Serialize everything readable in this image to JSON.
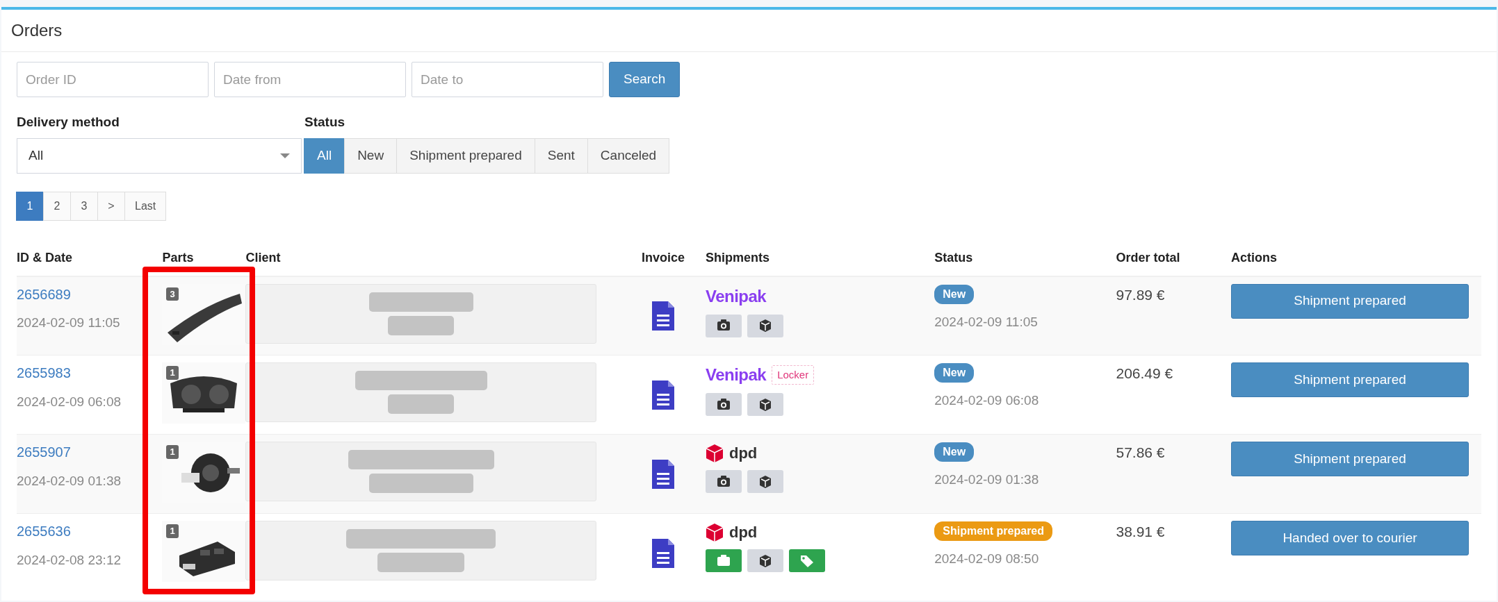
{
  "title": "Orders",
  "filters": {
    "fields": [
      {
        "placeholder": "Order ID"
      },
      {
        "placeholder": "Date from"
      },
      {
        "placeholder": "Date to"
      }
    ],
    "search_button": "Search",
    "delivery": {
      "label": "Delivery method",
      "value": "All"
    },
    "status": {
      "label": "Status",
      "options": [
        {
          "label": "All",
          "selected": true
        },
        {
          "label": "New",
          "selected": false
        },
        {
          "label": "Shipment prepared",
          "selected": false
        },
        {
          "label": "Sent",
          "selected": false
        },
        {
          "label": "Canceled",
          "selected": false
        }
      ]
    }
  },
  "pagination": [
    {
      "label": "1",
      "selected": true
    },
    {
      "label": "2",
      "selected": false
    },
    {
      "label": "3",
      "selected": false
    },
    {
      "label": ">",
      "selected": false
    },
    {
      "label": "Last",
      "selected": false
    }
  ],
  "table": {
    "columns": [
      "ID & Date",
      "Parts",
      "Client",
      "Invoice",
      "Shipments",
      "Status",
      "Order total",
      "Actions"
    ],
    "parts_highlighted": true,
    "rows": [
      {
        "id": "2656689",
        "date": "2024-02-09 11:05",
        "parts_count": "3",
        "carrier": {
          "kind": "venipak",
          "name": "Venipak"
        },
        "tags": [],
        "shipment_buttons": [
          {
            "kind": "camera",
            "done": false
          },
          {
            "kind": "box",
            "done": false
          }
        ],
        "status": {
          "label": "New",
          "color": "#4a8dc1"
        },
        "status_date": "2024-02-09 11:05",
        "total": "97.89 €",
        "action": "Shipment prepared"
      },
      {
        "id": "2655983",
        "date": "2024-02-09 06:08",
        "parts_count": "1",
        "carrier": {
          "kind": "venipak",
          "name": "Venipak"
        },
        "tags": [
          "Locker"
        ],
        "shipment_buttons": [
          {
            "kind": "camera",
            "done": false
          },
          {
            "kind": "box",
            "done": false
          }
        ],
        "status": {
          "label": "New",
          "color": "#4a8dc1"
        },
        "status_date": "2024-02-09 06:08",
        "total": "206.49 €",
        "action": "Shipment prepared"
      },
      {
        "id": "2655907",
        "date": "2024-02-09 01:38",
        "parts_count": "1",
        "carrier": {
          "kind": "dpd",
          "name": "dpd"
        },
        "tags": [],
        "shipment_buttons": [
          {
            "kind": "camera",
            "done": false
          },
          {
            "kind": "box",
            "done": false
          }
        ],
        "status": {
          "label": "New",
          "color": "#4a8dc1"
        },
        "status_date": "2024-02-09 01:38",
        "total": "57.86 €",
        "action": "Shipment prepared"
      },
      {
        "id": "2655636",
        "date": "2024-02-08 23:12",
        "parts_count": "1",
        "carrier": {
          "kind": "dpd",
          "name": "dpd"
        },
        "tags": [],
        "shipment_buttons": [
          {
            "kind": "camera",
            "done": true
          },
          {
            "kind": "box",
            "done": false
          },
          {
            "kind": "tag",
            "done": true
          }
        ],
        "status": {
          "label": "Shipment prepared",
          "color": "#eb9a13"
        },
        "status_date": "2024-02-09 08:50",
        "total": "38.91 €",
        "action": "Handed over to courier"
      }
    ]
  }
}
